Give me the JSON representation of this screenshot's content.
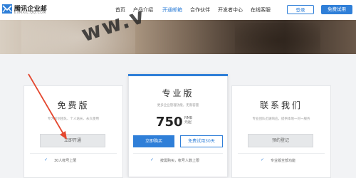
{
  "nav": {
    "logo_title": "腾讯企业邮",
    "logo_sub": "EXMAIL.QQ.COM",
    "items": [
      "首页",
      "产品介绍",
      "开通邮箱",
      "合作伙伴",
      "开发者中心",
      "在线客服"
    ],
    "login_label": "登录",
    "trial_label": "免费试用"
  },
  "hero": {
    "watermark": "ww.v"
  },
  "plans": {
    "free": {
      "title": "免费版",
      "desc": "专为初创团队、个人站长、永久使用",
      "button": "立即开通",
      "feature": "30人帐号上限"
    },
    "pro": {
      "title": "专业版",
      "desc": "更多企业管理功能，无限容量",
      "price": "750",
      "unit_line1": "RMB",
      "unit_line2": "元起",
      "buy_button": "立即购买",
      "trial_button": "免费试用30天",
      "feature": "按需购买，帐号人数上限"
    },
    "contact": {
      "title": "联系我们",
      "desc": "专业团队迅速响应，提供本地一对一服务",
      "button": "预约登记",
      "feature": "专业版全部功能"
    }
  },
  "colors": {
    "accent": "#2f7fd8",
    "arrow": "#e4472f"
  }
}
